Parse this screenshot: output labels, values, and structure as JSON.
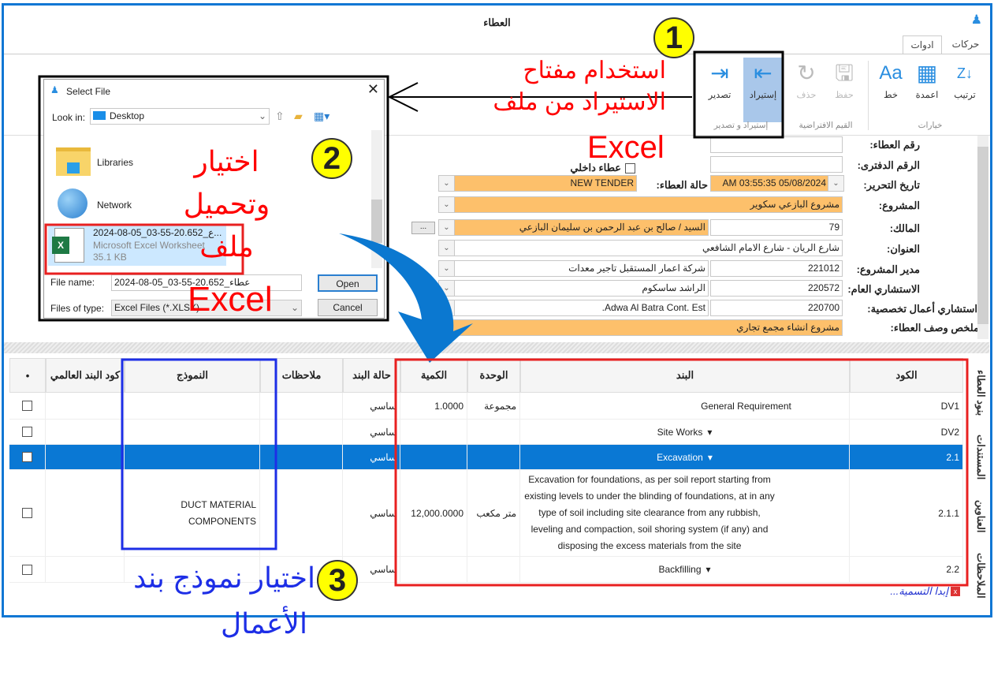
{
  "window": {
    "title": "العطاء"
  },
  "tabs": [
    {
      "label": "حركات"
    },
    {
      "label": "ادوات",
      "active": true
    }
  ],
  "ribbon": {
    "options": {
      "label": "خيارات",
      "buttons": [
        {
          "label": "ترتيب",
          "icon": "sort-za-icon"
        },
        {
          "label": "اعمدة",
          "icon": "columns-settings-icon"
        },
        {
          "label": "خط",
          "icon": "font-icon"
        }
      ]
    },
    "defaults": {
      "label": "القيم الافتراضية",
      "buttons": [
        {
          "label": "حفظ",
          "icon": "save-icon",
          "disabled": true
        },
        {
          "label": "حذف",
          "icon": "refresh-icon",
          "disabled": true
        }
      ]
    },
    "import_export": {
      "label": "إستيراد و تصدير",
      "buttons": [
        {
          "label": "إستيراد",
          "icon": "import-icon",
          "highlighted": true
        },
        {
          "label": "تصدير",
          "icon": "export-icon"
        }
      ]
    }
  },
  "form": {
    "tender_number": {
      "label": "رقم العطاء:",
      "value": ""
    },
    "book_number": {
      "label": "الرقم الدفترى:",
      "value": ""
    },
    "internal_tender": {
      "label": "عطاء داخلي",
      "checked": false
    },
    "edit_date": {
      "label": "تاريخ التحرير:",
      "value": "05/08/2024 03:55:35 AM"
    },
    "tender_status": {
      "label": "حالة العطاء:",
      "value": "NEW TENDER"
    },
    "project": {
      "label": "المشروع:",
      "value": "مشروع البازعي سكوير"
    },
    "owner": {
      "label": "المالك:",
      "code": "79",
      "value": "السيد / صالح بن عبد الرحمن بن سليمان البازعي",
      "more": "..."
    },
    "address": {
      "label": "العنوان:",
      "value": "شارع الريان - شارع الامام الشافعي"
    },
    "project_manager": {
      "label": "مدير المشروع:",
      "code": "221012",
      "value": "شركة اعمار المستقبل تاجير معدات"
    },
    "general_consultant": {
      "label": "الاستشاري العام:",
      "code": "220572",
      "value": "الراشد ساسكوم"
    },
    "specialty_consultant": {
      "label": "استشاري أعمال تخصصية:",
      "code": "220700",
      "value": "Adwa Al Batra Cont. Est."
    },
    "summary": {
      "label": "ملخص وصف العطاء:",
      "value": "مشروع انشاء مجمع تجاري"
    }
  },
  "dialog": {
    "title": "Select File",
    "look_in_label": "Look in:",
    "look_in": "Desktop",
    "items": [
      {
        "name": "Libraries",
        "icon": "libraries-folder-icon"
      },
      {
        "name": "Network",
        "icon": "network-icon"
      }
    ],
    "selected_file": {
      "name": "2024-08-05_03-55-20.652_ع...",
      "type": "Microsoft Excel Worksheet",
      "size": "35.1 KB"
    },
    "file_name_label": "File name:",
    "file_name": "2024-08-05_03-55-20.652_عطاء",
    "file_type_label": "Files of type:",
    "file_type": "Excel Files (*.XLSX)",
    "open": "Open",
    "cancel": "Cancel"
  },
  "grid": {
    "headers": {
      "code": "الكود",
      "item": "البند",
      "unit": "الوحدة",
      "qty": "الكمية",
      "status": "حالة البند",
      "notes": "ملاحظات",
      "template": "النموذج",
      "global_code": "كود البند العالمي",
      "select": "•"
    },
    "rows": [
      {
        "code": "DV1",
        "item": "General Requirement",
        "unit": "مجموعة",
        "qty": "1.0000",
        "status": "ساسي",
        "template": ""
      },
      {
        "code": "DV2",
        "item": "Site Works",
        "unit": "",
        "qty": "",
        "status": "ساسي",
        "template": "",
        "expand": true
      },
      {
        "code": "2.1",
        "item": "Excavation",
        "unit": "",
        "qty": "",
        "status": "ساسي",
        "template": "",
        "expand": true,
        "selected": true
      },
      {
        "code": "2.1.1",
        "item": "Excavation for foundations, as per soil report starting from existing  levels to under the blinding of foundations, at in any type of soil including site clearance from any rubbish, leveling and compaction, soil shoring system (if any) and disposing the excess materials from the site",
        "unit": "متر مكعب",
        "qty": "12,000.0000",
        "status": "ساسي",
        "template": "DUCT MATERIAL COMPONENTS"
      },
      {
        "code": "2.2",
        "item": "Backfilling",
        "unit": "",
        "qty": "",
        "status": "ساسي",
        "template": "",
        "expand": true
      }
    ],
    "side_tabs": [
      "بنود العطاء",
      "المستندات",
      "العناوين",
      "الملاحظات"
    ],
    "footer": "إبدا التسمية..."
  },
  "annotations": {
    "step1": {
      "number": "1",
      "lines": [
        "استخدام مفتاح",
        "الاستيراد من ملف",
        "Excel"
      ]
    },
    "step2": {
      "number": "2",
      "lines": [
        "اختيار",
        "وتحميل",
        "ملف",
        "Excel"
      ]
    },
    "step3": {
      "number": "3",
      "lines": [
        "اختيار نموذج بند",
        "الأعمال"
      ]
    }
  },
  "colors": {
    "accent": "#0a78d4",
    "highlight_field": "#fdc06b",
    "annotation_red": "#ff0000",
    "annotation_blue": "#1d2ee6",
    "step_circle": "#ffff00"
  }
}
